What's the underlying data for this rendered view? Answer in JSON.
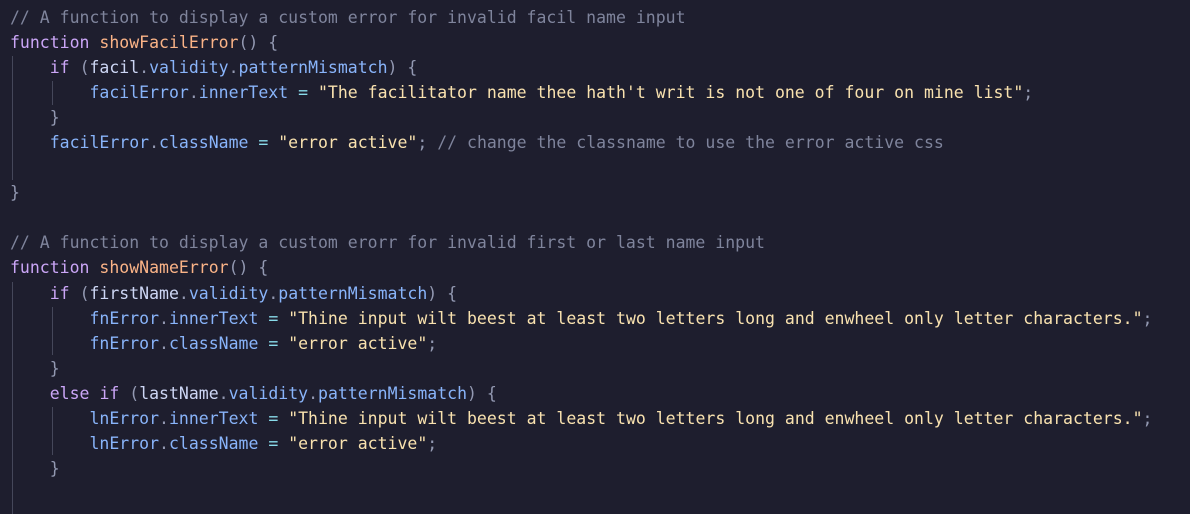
{
  "code": {
    "comment1": "// A function to display a custom error for invalid facil name input",
    "kw_function": "function",
    "fn1": "showFacilError",
    "kw_if": "if",
    "id_facil": "facil",
    "prop_validity": "validity",
    "prop_patternMismatch": "patternMismatch",
    "id_facilError": "facilError",
    "prop_innerText": "innerText",
    "str_facil_msg": "\"The facilitator name thee hath't writ is not one of four on mine list\"",
    "prop_className": "className",
    "str_error_active": "\"error active\"",
    "comment2": "// change the classname to use the error active css",
    "comment3": "// A function to display a custom erorr for invalid first or last name input",
    "fn2": "showNameError",
    "id_firstName": "firstName",
    "id_fnError": "fnError",
    "str_name_msg": "\"Thine input wilt beest at least two letters long and enwheel only letter characters.\"",
    "kw_else": "else",
    "id_lastName": "lastName",
    "id_lnError": "lnError"
  }
}
